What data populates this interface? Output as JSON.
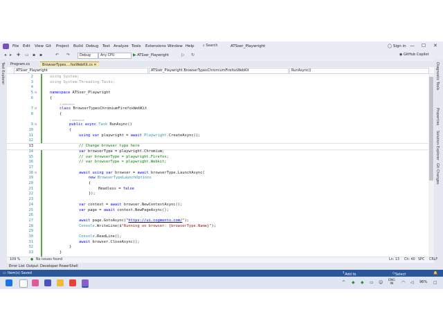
{
  "menu": {
    "items": [
      "File",
      "Edit",
      "View",
      "Git",
      "Project",
      "Build",
      "Debug",
      "Test",
      "Analyze",
      "Tools",
      "Extensions",
      "Window",
      "Help"
    ],
    "search": "Search",
    "solution": "ATSser_Playwright",
    "signin": "Sign in",
    "minimize": "—",
    "maximize": "☐",
    "close": "✕"
  },
  "toolbar": {
    "config": "Debug",
    "platform": "Any CPU",
    "run_target": "ATSser_Playwright",
    "copilot": "GitHub Copilot"
  },
  "side": {
    "left": "Test Explorer",
    "right": [
      "Diagnostic Tools",
      "Properties",
      "Solution Explorer",
      "Git Changes"
    ]
  },
  "tabs": [
    {
      "label": "Program.cs",
      "active": false
    },
    {
      "label": "BrowserTypes....foxWebKit.cs",
      "active": true
    }
  ],
  "navbar": {
    "project": "ATSser_Playwright",
    "class": "ATSser_Playwright.BrowserTypesChromiumFirefoxWebKit",
    "member": "RunAsync()"
  },
  "editor": {
    "current_line": "13",
    "lines": [
      {
        "n": "2",
        "i": 0,
        "t": "using System;",
        "c": "gr"
      },
      {
        "n": "3",
        "i": 0,
        "t": "using System.Threading.Tasks;",
        "c": "gr"
      },
      {
        "n": "4",
        "i": 0,
        "t": ""
      },
      {
        "n": "5",
        "i": 0,
        "t": "namespace ATSser_Playwright",
        "c": "ns"
      },
      {
        "n": "6",
        "i": 0,
        "t": "{"
      },
      {
        "n": "",
        "i": 1,
        "t": "1 reference",
        "c": "ref"
      },
      {
        "n": "7",
        "i": 1,
        "t": "class BrowserTypesChromiumFirefoxWebKit",
        "c": "cls"
      },
      {
        "n": "8",
        "i": 1,
        "t": "{"
      },
      {
        "n": "",
        "i": 2,
        "t": "1 reference",
        "c": "ref"
      },
      {
        "n": "9",
        "i": 2,
        "t": "public async Task RunAsync()",
        "c": "sig"
      },
      {
        "n": "10",
        "i": 2,
        "t": "{"
      },
      {
        "n": "11",
        "i": 3,
        "t": "using var playwright = await Playwright.CreateAsync();"
      },
      {
        "n": "12",
        "i": 3,
        "t": ""
      },
      {
        "n": "13",
        "i": 3,
        "t": "// Change browser type here",
        "c": "cm"
      },
      {
        "n": "14",
        "i": 3,
        "t": "var browserType = playwright.Chromium;"
      },
      {
        "n": "15",
        "i": 3,
        "t": "// var browserType = playwright.Firefox;",
        "c": "cm"
      },
      {
        "n": "16",
        "i": 3,
        "t": "// var browserType = playwright.Webkit;",
        "c": "cm"
      },
      {
        "n": "17",
        "i": 3,
        "t": ""
      },
      {
        "n": "18",
        "i": 3,
        "t": "await using var browser = await browserType.LaunchAsync("
      },
      {
        "n": "19",
        "i": 4,
        "t": "new BrowserTypeLaunchOptions"
      },
      {
        "n": "20",
        "i": 4,
        "t": "{"
      },
      {
        "n": "21",
        "i": 5,
        "t": "Headless = false"
      },
      {
        "n": "22",
        "i": 4,
        "t": "});"
      },
      {
        "n": "23",
        "i": 3,
        "t": ""
      },
      {
        "n": "24",
        "i": 3,
        "t": "var context = await browser.NewContextAsync();"
      },
      {
        "n": "25",
        "i": 3,
        "t": "var page = await context.NewPageAsync();"
      },
      {
        "n": "26",
        "i": 3,
        "t": ""
      },
      {
        "n": "27",
        "i": 3,
        "t": "await page.GotoAsync(\"https://ui.cogmento.com/\");"
      },
      {
        "n": "28",
        "i": 3,
        "t": "Console.WriteLine($\"Running on browser: {browserType.Name}\");"
      },
      {
        "n": "29",
        "i": 3,
        "t": ""
      },
      {
        "n": "30",
        "i": 3,
        "t": "Console.ReadLine();"
      },
      {
        "n": "31",
        "i": 3,
        "t": "await browser.CloseAsync();"
      },
      {
        "n": "32",
        "i": 2,
        "t": "}"
      },
      {
        "n": "33",
        "i": 1,
        "t": "}"
      }
    ]
  },
  "editor_status": {
    "zoom": "109 %",
    "issues": "No issues found",
    "position": "Ln: 13",
    "column": "Ch: 40",
    "whitespace": "SPC",
    "line_endings": "CRLF"
  },
  "panel_tabs": [
    "Error List",
    "Output",
    "Developer PowerShell"
  ],
  "statusbar": {
    "left": "Item(s) Saved",
    "source_control": "Add to Source Control",
    "repo": "Select Repository"
  },
  "taskbar": {
    "lang_top": "ENG",
    "lang_bottom": "IN",
    "battery": "96%"
  },
  "colors": {
    "accent": "#7b4fb8",
    "statusbar": "#2b579a",
    "run": "#1f8c3a",
    "keyword": "#0000ff",
    "type": "#2b91af",
    "comment": "#008000",
    "string": "#a31515"
  }
}
